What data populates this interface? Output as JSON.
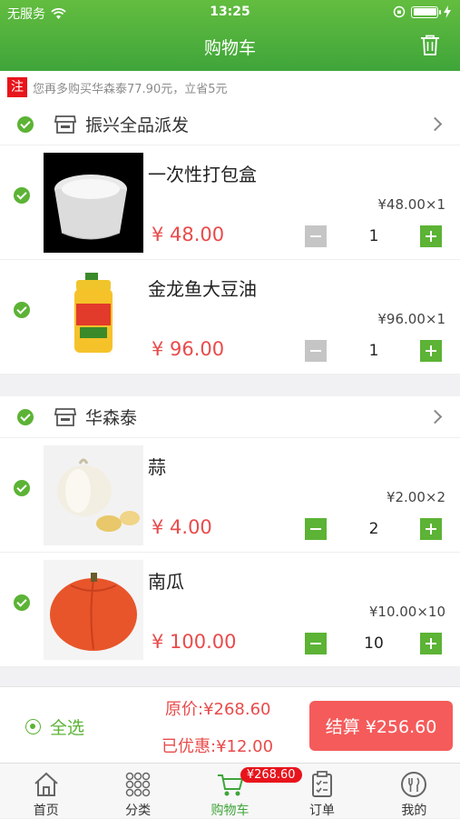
{
  "status_bar": {
    "carrier": "无服务",
    "time": "13:25"
  },
  "nav": {
    "title": "购物车"
  },
  "notice": {
    "tag": "注",
    "text": "您再多购买华森泰77.90元，立省5元"
  },
  "stores": [
    {
      "name": "振兴全品派发",
      "items": [
        {
          "name": "一次性打包盒",
          "unit": "¥48.00×1",
          "price": "¥ 48.00",
          "qty": "1"
        },
        {
          "name": "金龙鱼大豆油",
          "unit": "¥96.00×1",
          "price": "¥ 96.00",
          "qty": "1"
        }
      ]
    },
    {
      "name": "华森泰",
      "items": [
        {
          "name": "蒜",
          "unit": "¥2.00×2",
          "price": "¥ 4.00",
          "qty": "2"
        },
        {
          "name": "南瓜",
          "unit": "¥10.00×10",
          "price": "¥ 100.00",
          "qty": "10"
        }
      ]
    }
  ],
  "footer": {
    "select_all": "全选",
    "original": "原价:¥268.60",
    "discount": "已优惠:¥12.00",
    "checkout": "结算 ¥256.60"
  },
  "tabs": [
    {
      "label": "首页"
    },
    {
      "label": "分类"
    },
    {
      "label": "购物车",
      "badge": "¥268.60"
    },
    {
      "label": "订单"
    },
    {
      "label": "我的"
    }
  ],
  "colors": {
    "brand_green": "#3fa53a",
    "price_red": "#e94b4b",
    "checkout_red": "#f55b5b",
    "notice_red": "#e8141c"
  }
}
